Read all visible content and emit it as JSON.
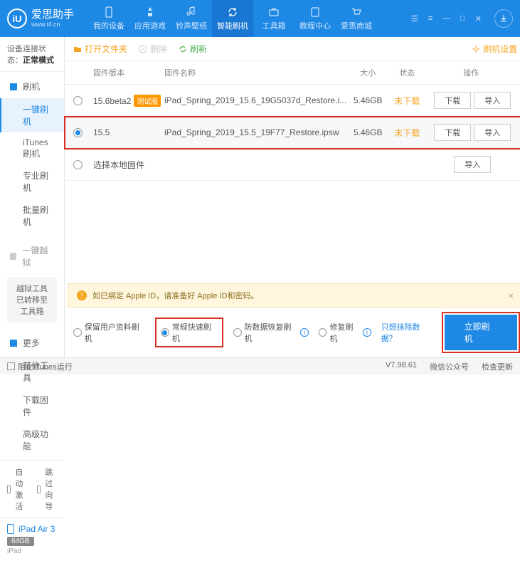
{
  "brand": {
    "name": "爱思助手",
    "url": "www.i4.cn",
    "logo": "iU"
  },
  "nav": [
    {
      "label": "我的设备"
    },
    {
      "label": "应用游戏"
    },
    {
      "label": "铃声壁纸"
    },
    {
      "label": "智能刷机"
    },
    {
      "label": "工具箱"
    },
    {
      "label": "教程中心"
    },
    {
      "label": "爱思商城"
    }
  ],
  "winctrls": {
    "menu": "☰",
    "settings": "≡",
    "min": "—",
    "max": "□",
    "close": "✕"
  },
  "sidebar": {
    "conn_label": "设备连接状态：",
    "conn_value": "正常模式",
    "g1": {
      "head": "刷机",
      "items": [
        "一键刷机",
        "iTunes刷机",
        "专业刷机",
        "批量刷机"
      ]
    },
    "g2": {
      "head": "一键越狱",
      "note": "越狱工具已转移至工具箱"
    },
    "g3": {
      "head": "更多",
      "items": [
        "其他工具",
        "下载固件",
        "高级功能"
      ]
    },
    "auto": "自动激活",
    "skip": "跳过向导",
    "device": {
      "name": "iPad Air 3",
      "storage": "64GB",
      "type": "iPad"
    }
  },
  "toolbar": {
    "open": "打开文件夹",
    "del": "删除",
    "refresh": "刷新",
    "settings": "刷机设置"
  },
  "table": {
    "h": {
      "ver": "固件版本",
      "name": "固件名称",
      "size": "大小",
      "status": "状态",
      "ops": "操作"
    },
    "rows": [
      {
        "ver": "15.6beta2",
        "beta": "测试版",
        "name": "iPad_Spring_2019_15.6_19G5037d_Restore.i...",
        "size": "5.46GB",
        "status": "未下载"
      },
      {
        "ver": "15.5",
        "name": "iPad_Spring_2019_15.5_19F77_Restore.ipsw",
        "size": "5.46GB",
        "status": "未下载"
      }
    ],
    "local": "选择本地固件",
    "btn": {
      "dl": "下载",
      "imp": "导入"
    }
  },
  "warn": "如已绑定 Apple ID，请准备好 Apple ID和密码。",
  "options": {
    "o1": "保留用户资料刷机",
    "o2": "常规快速刷机",
    "o3": "防数据恢复刷机",
    "o4": "修复刷机",
    "link": "只想抹除数据？",
    "flash": "立即刷机"
  },
  "status": {
    "block": "阻止iTunes运行",
    "ver": "V7.98.61",
    "wx": "微信公众号",
    "upd": "检查更新"
  }
}
